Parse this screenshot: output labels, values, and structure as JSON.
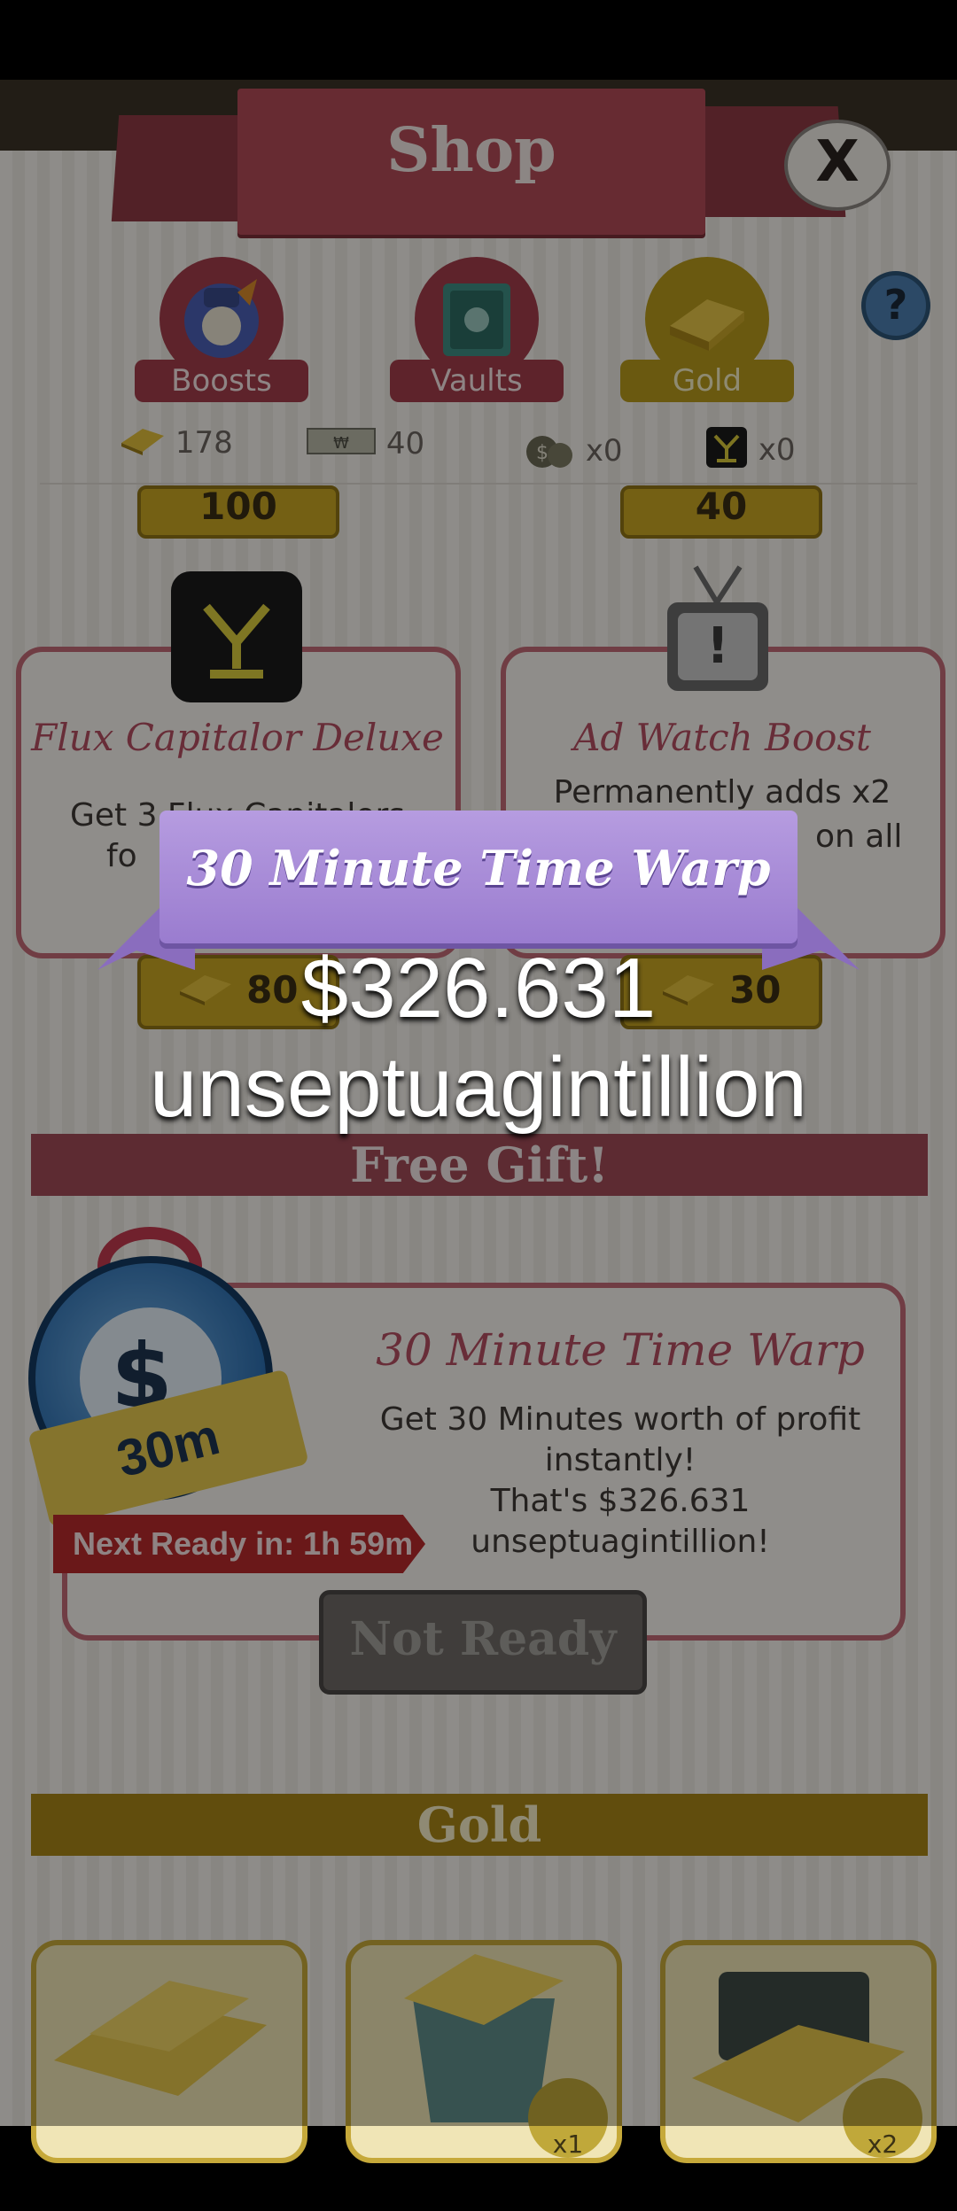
{
  "shop": {
    "title": "Shop",
    "close_label": "X",
    "help_label": "?",
    "categories": [
      {
        "label": "Boosts",
        "icon": "boost-bag-icon"
      },
      {
        "label": "Vaults",
        "icon": "vault-icon"
      },
      {
        "label": "Gold",
        "icon": "gold-bars-icon"
      }
    ],
    "currencies": [
      {
        "icon": "gold-bar-icon",
        "value": "178"
      },
      {
        "icon": "megabucks-icon",
        "value": "40"
      },
      {
        "icon": "money-bag-icon",
        "value": "x0"
      },
      {
        "icon": "flux-capitalor-icon",
        "value": "x0"
      }
    ],
    "top_prices": [
      "100",
      "40"
    ],
    "cards": [
      {
        "title": "Flux Capitalor Deluxe",
        "desc_line1": "Get 3 Flux Capitalors",
        "desc_line2": "fo",
        "price": "80",
        "icon": "flux-capitalor-icon"
      },
      {
        "title": "Ad Watch Boost",
        "desc_line1": "Permanently adds x2",
        "desc_line2": "on all",
        "price": "30",
        "icon": "tv-icon"
      }
    ],
    "free_gift": {
      "section_title": "Free Gift!",
      "title": "30 Minute Time Warp",
      "desc_line1": "Get 30 Minutes worth of profit",
      "desc_line2": "instantly!",
      "desc_line3": "That's $326.631 unseptuagintillion!",
      "badge": "30m",
      "next_ready": "Next Ready in: 1h 59m",
      "button": "Not Ready"
    },
    "gold_section": {
      "title": "Gold",
      "items": [
        {
          "badge": ""
        },
        {
          "badge": "x1"
        },
        {
          "badge": "x2"
        }
      ]
    }
  },
  "popup": {
    "title": "30 Minute Time Warp",
    "amount_line1": "$326.631",
    "amount_line2": "unseptuagintillion"
  },
  "colors": {
    "shop_red": "#b14b57",
    "gold": "#c8a623",
    "popup_purple": "#9a7ccf"
  }
}
